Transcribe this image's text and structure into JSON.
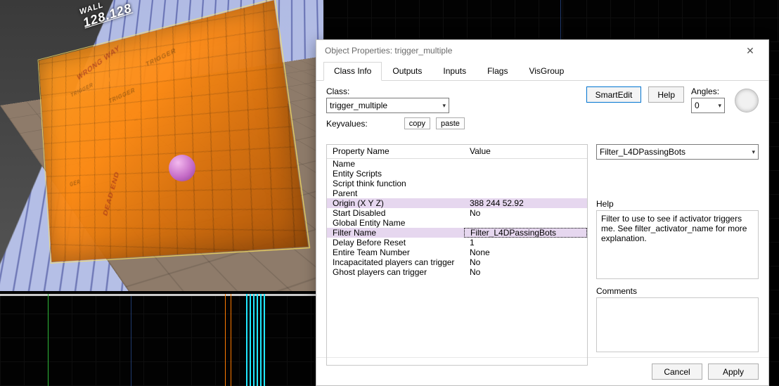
{
  "viewport": {
    "wall_label_text": "WALL",
    "wall_label_value": "128.128",
    "brush_text_samples": [
      "TRIGGER",
      "TRIGGER",
      "TRIGGER",
      "GER",
      "WRONG WAY",
      "DEAD END"
    ]
  },
  "dialog": {
    "title": "Object Properties: trigger_multiple",
    "tabs": [
      "Class Info",
      "Outputs",
      "Inputs",
      "Flags",
      "VisGroup"
    ],
    "active_tab": 0,
    "class_label": "Class:",
    "class_value": "trigger_multiple",
    "keyvalues_label": "Keyvalues:",
    "copy_label": "copy",
    "paste_label": "paste",
    "smartedit_label": "SmartEdit",
    "help_btn_label": "Help",
    "angles_label": "Angles:",
    "angles_value": "0",
    "table_headers": {
      "property": "Property Name",
      "value": "Value"
    },
    "rows": [
      {
        "p": "Name",
        "v": ""
      },
      {
        "p": "Entity Scripts",
        "v": ""
      },
      {
        "p": "Script think function",
        "v": ""
      },
      {
        "p": "Parent",
        "v": ""
      },
      {
        "p": "Origin (X Y Z)",
        "v": "388 244 52.92",
        "sel": true
      },
      {
        "p": "Start Disabled",
        "v": "No"
      },
      {
        "p": "Global Entity Name",
        "v": ""
      },
      {
        "p": "Filter Name",
        "v": "Filter_L4DPassingBots",
        "focus": true
      },
      {
        "p": "Delay Before Reset",
        "v": "1"
      },
      {
        "p": "Entire Team Number",
        "v": "None"
      },
      {
        "p": "Incapacitated players can trigger",
        "v": "No"
      },
      {
        "p": "Ghost players can trigger",
        "v": "No"
      }
    ],
    "side_input_value": "Filter_L4DPassingBots",
    "help_label": "Help",
    "help_text": "Filter to use to see if activator triggers me. See filter_activator_name for more explanation.",
    "comments_label": "Comments",
    "cancel_label": "Cancel",
    "apply_label": "Apply"
  }
}
